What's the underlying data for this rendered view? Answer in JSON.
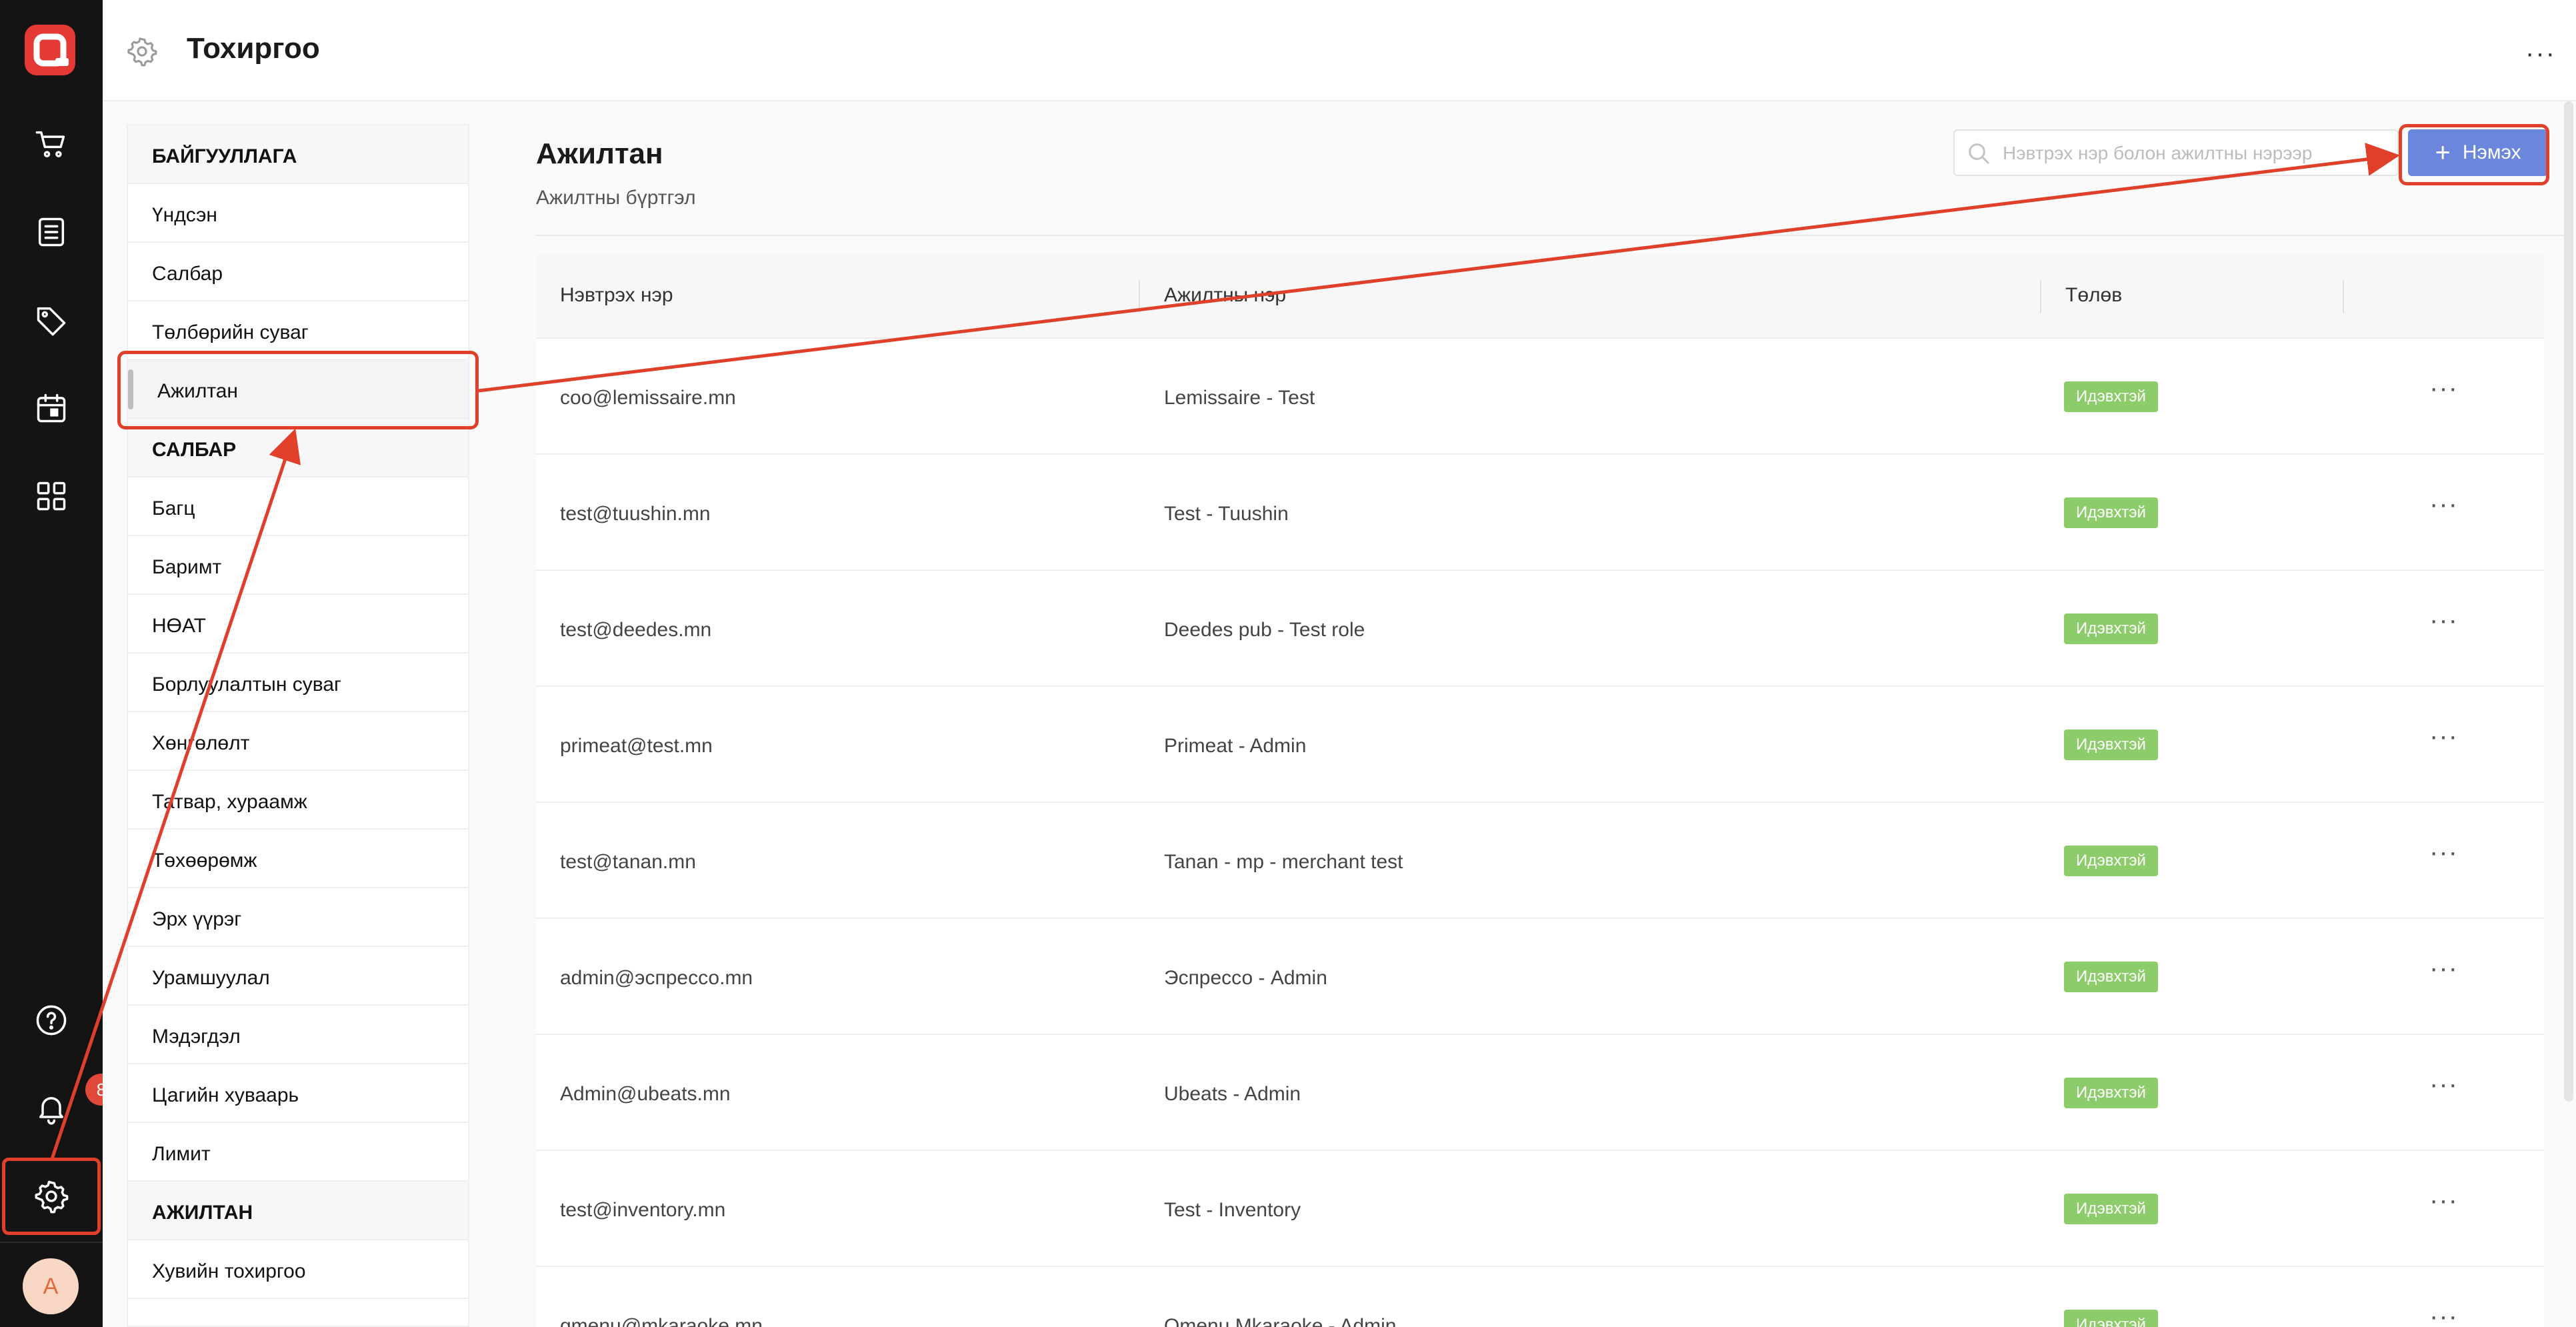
{
  "app": {
    "logo": "q-logo-icon",
    "accent_color": "#e53935",
    "rail_icons": [
      "cart-icon",
      "list-icon",
      "tag-icon",
      "calendar-icon",
      "grid-icon",
      "help-icon",
      "bell-icon",
      "gear-icon"
    ],
    "notification_count": "8",
    "avatar_initial": "A"
  },
  "header": {
    "title": "Тохиргоо",
    "more_label": "···"
  },
  "menu": {
    "sections": [
      {
        "title": "БАЙГУУЛЛАГА",
        "items": [
          "Үндсэн",
          "Салбар",
          "Төлбөрийн суваг",
          "Ажилтан"
        ]
      },
      {
        "title": "САЛБАР",
        "items": [
          "Багц",
          "Баримт",
          "НӨАТ",
          "Борлуулалтын суваг",
          "Хөнгөлөлт",
          "Татвар, хураамж",
          "Төхөөрөмж",
          "Эрх үүрэг",
          "Урамшуулал",
          "Мэдэгдэл",
          "Цагийн хуваарь",
          "Лимит"
        ]
      },
      {
        "title": "АЖИЛТАН",
        "items": [
          "Хувийн тохиргоо"
        ]
      }
    ],
    "active_item": "Ажилтан"
  },
  "page": {
    "heading": "Ажилтан",
    "subheading": "Ажилтны бүртгэл",
    "search_placeholder": "Нэвтрэх нэр болон ажилтны нэрээр",
    "add_button_label": "Нэмэх",
    "add_button_color": "#6b87dc"
  },
  "table": {
    "columns": [
      "Нэвтрэх нэр",
      "Ажилтны нэр",
      "Төлөв"
    ],
    "status_color": "#8dcc6a",
    "rows": [
      {
        "login": "coo@lemissaire.mn",
        "name": "Lemissaire - Test",
        "status": "Идэвхтэй"
      },
      {
        "login": "test@tuushin.mn",
        "name": "Test - Tuushin",
        "status": "Идэвхтэй"
      },
      {
        "login": "test@deedes.mn",
        "name": "Deedes pub - Test role",
        "status": "Идэвхтэй"
      },
      {
        "login": "primeat@test.mn",
        "name": "Primeat - Admin",
        "status": "Идэвхтэй"
      },
      {
        "login": "test@tanan.mn",
        "name": "Tanan - mp - merchant test",
        "status": "Идэвхтэй"
      },
      {
        "login": "admin@эспрессо.mn",
        "name": "Эспрессо - Admin",
        "status": "Идэвхтэй"
      },
      {
        "login": "Admin@ubeats.mn",
        "name": "Ubeats - Admin",
        "status": "Идэвхтэй"
      },
      {
        "login": "test@inventory.mn",
        "name": "Test - Inventory",
        "status": "Идэвхтэй"
      },
      {
        "login": "qmenu@mkaraoke.mn",
        "name": "Qmenu Mkaraoke - Admin",
        "status": "Идэвхтэй"
      }
    ],
    "row_more_label": "···"
  }
}
